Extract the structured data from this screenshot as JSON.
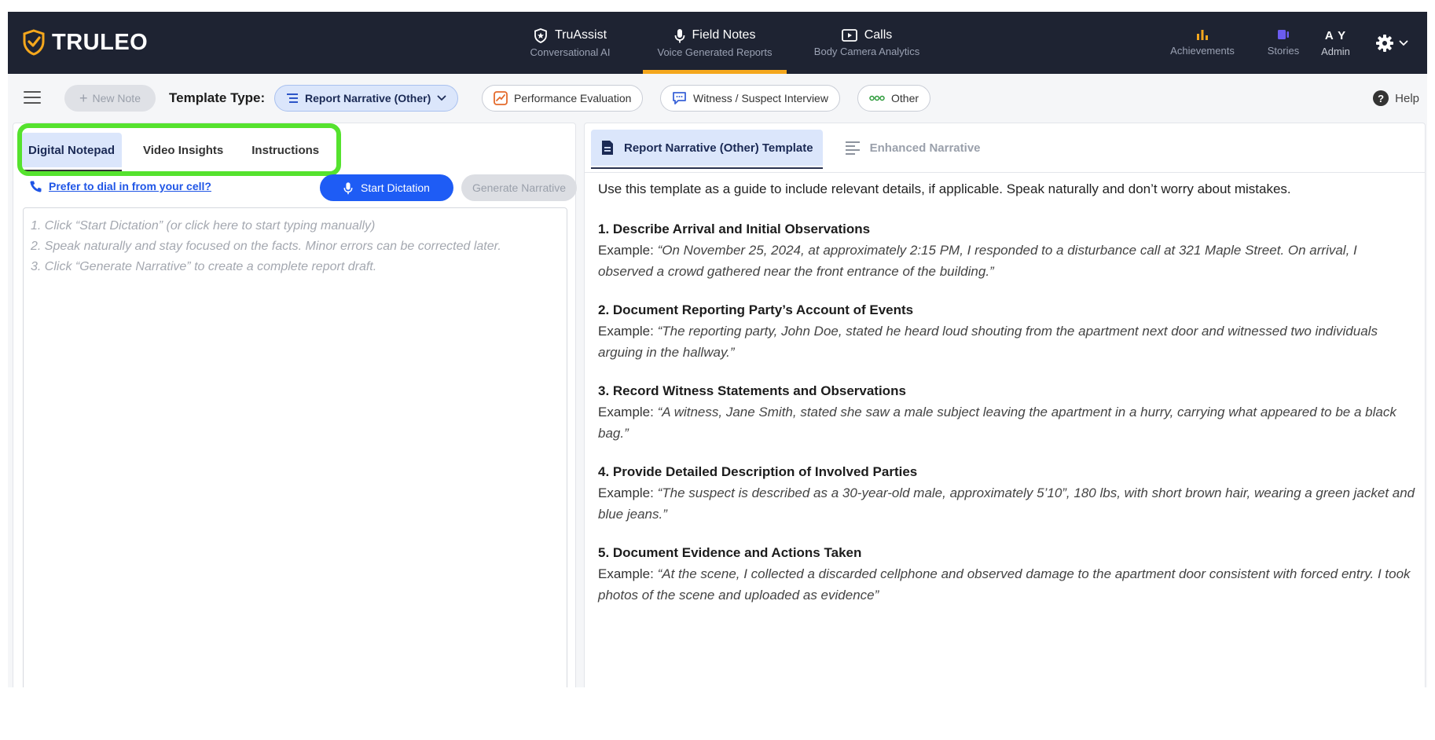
{
  "brand": {
    "name": "TRULEO"
  },
  "nav": [
    {
      "title": "TruAssist",
      "subtitle": "Conversational AI",
      "icon": "shield-star-icon"
    },
    {
      "title": "Field Notes",
      "subtitle": "Voice Generated Reports",
      "icon": "microphone-icon",
      "active": true
    },
    {
      "title": "Calls",
      "subtitle": "Body Camera Analytics",
      "icon": "play-box-icon"
    }
  ],
  "right_nav": {
    "achievements": "Achievements",
    "stories": "Stories",
    "user_initials": "A Y",
    "user_role": "Admin"
  },
  "toolbar": {
    "new_note": "New Note",
    "template_type_label": "Template Type:",
    "template_selected": "Report Narrative (Other)",
    "chips": [
      "Performance Evaluation",
      "Witness / Suspect Interview",
      "Other"
    ],
    "help": "Help"
  },
  "left": {
    "tabs": [
      "Digital Notepad",
      "Video Insights",
      "Instructions"
    ],
    "dial_link": "Prefer to dial in from your cell?",
    "start_dictation": "Start Dictation",
    "generate_narrative": "Generate Narrative",
    "placeholder_lines": [
      "1. Click “Start Dictation” (or click here to start typing manually)",
      "2. Speak naturally and stay focused on the facts. Minor errors can be corrected later.",
      "3. Click “Generate Narrative” to create a complete report draft."
    ]
  },
  "right": {
    "tabs": [
      "Report Narrative (Other) Template",
      "Enhanced Narrative"
    ],
    "intro": "Use this template as a guide to include relevant details, if applicable. Speak naturally and don’t worry about mistakes.",
    "example_prefix": "Example:",
    "sections": [
      {
        "title": "1. Describe Arrival and Initial Observations",
        "example": "“On November 25, 2024, at approximately 2:15 PM, I responded to a disturbance call at 321 Maple Street. On arrival, I observed a crowd gathered near the front entrance of the building.”"
      },
      {
        "title": "2. Document Reporting Party’s Account of Events",
        "example": "“The reporting party, John Doe, stated he heard loud shouting from the apartment next door and witnessed two individuals arguing in the hallway.”"
      },
      {
        "title": "3. Record Witness Statements and Observations",
        "example": "“A witness, Jane Smith, stated she saw a male subject leaving the apartment in a hurry, carrying what appeared to be a black bag.”"
      },
      {
        "title": "4. Provide Detailed Description of Involved Parties",
        "example": "“The suspect is described as a 30-year-old male, approximately 5’10”, 180 lbs, with short brown hair, wearing a green jacket and blue jeans.”"
      },
      {
        "title": "5. Document Evidence and Actions Taken",
        "example": "“At the scene, I collected a discarded cellphone and observed damage to the apartment door consistent with forced entry. I took photos of the scene and uploaded as evidence”"
      }
    ]
  },
  "colors": {
    "nav_bg": "#1e2332",
    "accent_orange": "#f4a71d",
    "primary_blue": "#1e5cf5",
    "highlight_green": "#55e22e"
  }
}
